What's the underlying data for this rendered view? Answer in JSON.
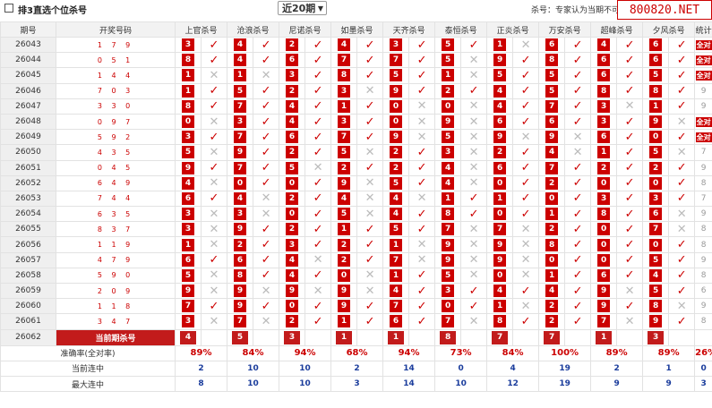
{
  "header": {
    "checkbox_label": "排3直选个位杀号",
    "period_select": "近20期",
    "note": "杀号：专家认为当期不可能开",
    "watermark": "800820.NET"
  },
  "columns": {
    "issue": "期号",
    "draw": "开奖号码",
    "experts": [
      "上官杀号",
      "沧浪杀号",
      "尼诺杀号",
      "如墨杀号",
      "天齐杀号",
      "泰恒杀号",
      "正炎杀号",
      "万安杀号",
      "超峰杀号",
      "夕风杀号"
    ],
    "stats": "统计"
  },
  "rows": [
    {
      "issue": "26043",
      "draw": "1 7 9",
      "picks": [
        3,
        4,
        2,
        4,
        3,
        5,
        1,
        6,
        4,
        6
      ],
      "tj": "全对"
    },
    {
      "issue": "26044",
      "draw": "0 5 1",
      "picks": [
        8,
        4,
        6,
        7,
        7,
        5,
        9,
        8,
        6,
        6
      ],
      "tj": "全对"
    },
    {
      "issue": "26045",
      "draw": "1 4 4",
      "picks": [
        1,
        1,
        3,
        8,
        5,
        1,
        5,
        5,
        6,
        5
      ],
      "tj": "全对"
    },
    {
      "issue": "26046",
      "draw": "7 0 3",
      "picks": [
        1,
        5,
        2,
        3,
        9,
        2,
        4,
        5,
        8,
        8
      ],
      "tj": "9"
    },
    {
      "issue": "26047",
      "draw": "3 3 0",
      "picks": [
        8,
        7,
        4,
        1,
        0,
        0,
        4,
        7,
        3,
        1
      ],
      "tj": "9"
    },
    {
      "issue": "26048",
      "draw": "0 9 7",
      "picks": [
        0,
        3,
        4,
        3,
        0,
        9,
        6,
        6,
        3,
        9
      ],
      "tj": "全对"
    },
    {
      "issue": "26049",
      "draw": "5 9 2",
      "picks": [
        3,
        7,
        6,
        7,
        9,
        5,
        9,
        9,
        6,
        0
      ],
      "tj": "全对"
    },
    {
      "issue": "26050",
      "draw": "4 3 5",
      "picks": [
        5,
        9,
        2,
        5,
        2,
        3,
        2,
        4,
        1,
        5
      ],
      "tj": "7"
    },
    {
      "issue": "26051",
      "draw": "0 4 5",
      "picks": [
        9,
        7,
        5,
        2,
        2,
        4,
        6,
        7,
        2,
        2
      ],
      "tj": "9"
    },
    {
      "issue": "26052",
      "draw": "6 4 9",
      "picks": [
        4,
        0,
        0,
        9,
        5,
        4,
        0,
        2,
        0,
        0
      ],
      "tj": "8"
    },
    {
      "issue": "26053",
      "draw": "7 4 4",
      "picks": [
        6,
        4,
        2,
        4,
        4,
        1,
        1,
        0,
        3,
        3
      ],
      "tj": "7"
    },
    {
      "issue": "26054",
      "draw": "6 3 5",
      "picks": [
        3,
        3,
        0,
        5,
        4,
        8,
        0,
        1,
        8,
        6
      ],
      "tj": "9"
    },
    {
      "issue": "26055",
      "draw": "8 3 7",
      "picks": [
        3,
        9,
        2,
        1,
        5,
        7,
        7,
        2,
        0,
        7
      ],
      "tj": "8"
    },
    {
      "issue": "26056",
      "draw": "1 1 9",
      "picks": [
        1,
        2,
        3,
        2,
        1,
        9,
        9,
        8,
        0,
        0
      ],
      "tj": "8"
    },
    {
      "issue": "26057",
      "draw": "4 7 9",
      "picks": [
        6,
        6,
        4,
        2,
        7,
        9,
        9,
        0,
        0,
        5
      ],
      "tj": "9"
    },
    {
      "issue": "26058",
      "draw": "5 9 0",
      "picks": [
        5,
        8,
        4,
        0,
        1,
        5,
        0,
        1,
        6,
        4
      ],
      "tj": "8"
    },
    {
      "issue": "26059",
      "draw": "2 0 9",
      "picks": [
        9,
        9,
        9,
        9,
        4,
        3,
        4,
        4,
        9,
        5
      ],
      "tj": "6"
    },
    {
      "issue": "26060",
      "draw": "1 1 8",
      "picks": [
        7,
        9,
        0,
        9,
        7,
        0,
        1,
        2,
        9,
        8
      ],
      "tj": "9"
    },
    {
      "issue": "26061",
      "draw": "3 4 7",
      "picks": [
        3,
        7,
        2,
        1,
        6,
        7,
        8,
        2,
        7,
        9
      ],
      "tj": "8"
    }
  ],
  "current": {
    "issue": "26062",
    "label": "当前期杀号",
    "picks": [
      "4",
      "5",
      "3",
      "1",
      "1",
      "8",
      "7",
      "7",
      "1",
      "3"
    ]
  },
  "stats": {
    "accuracy_label": "准确率(全对率)",
    "accuracy": [
      "89%",
      "84%",
      "94%",
      "68%",
      "94%",
      "73%",
      "84%",
      "100%",
      "89%",
      "89%",
      "26%"
    ],
    "streak_label": "当前连中",
    "streak": [
      "2",
      "10",
      "10",
      "2",
      "14",
      "0",
      "4",
      "19",
      "2",
      "1",
      "0"
    ],
    "max_label": "最大连中",
    "max": [
      "8",
      "10",
      "10",
      "3",
      "14",
      "10",
      "12",
      "19",
      "9",
      "9",
      "3"
    ]
  },
  "colors": {
    "accent": "#cc0000",
    "header_bg": "#f2f2f2",
    "blue": "#1a3c9c"
  }
}
